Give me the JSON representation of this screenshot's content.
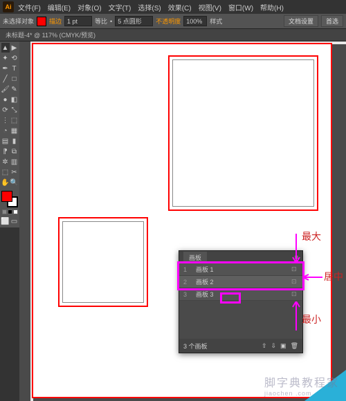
{
  "menu": {
    "items": [
      "文件(F)",
      "编辑(E)",
      "对象(O)",
      "文字(T)",
      "选择(S)",
      "效果(C)",
      "视图(V)",
      "窗口(W)",
      "帮助(H)"
    ]
  },
  "options": {
    "no_selection": "未选择对象",
    "stroke_label": "描边",
    "stroke_value": "1 pt",
    "uniform": "等比",
    "shape_label": "5 点圆形",
    "opacity_label": "不透明度",
    "opacity_value": "100%",
    "style_label": "样式",
    "doc_setup": "文档设置",
    "prefs": "首选"
  },
  "doc": {
    "tab": "未标题-4* @ 117% (CMYK/预览)"
  },
  "panel": {
    "title": "画板",
    "rows": [
      {
        "num": "1",
        "name": "画板 1"
      },
      {
        "num": "2",
        "name": "画板 2"
      },
      {
        "num": "3",
        "name": "画板 3"
      }
    ],
    "footer_count": "3 个画板"
  },
  "annotations": {
    "max": "最大",
    "mid": "居中",
    "min": "最小"
  },
  "watermark": "脚字典教程家",
  "watermark_sub": "jiaochen        .com"
}
